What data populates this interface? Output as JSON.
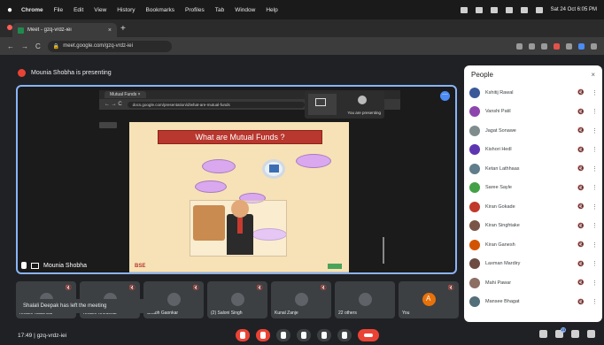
{
  "menubar": {
    "apple": "",
    "items": [
      "Chrome",
      "File",
      "Edit",
      "View",
      "History",
      "Bookmarks",
      "Profiles",
      "Tab",
      "Window",
      "Help"
    ],
    "clock": "Sat 24 Oct 6:05 PM"
  },
  "browser": {
    "tab_title": "Meet - gzq-vrdz-iei",
    "tab_close": "×",
    "new_tab": "+",
    "url": "meet.google.com/gzq-vrdz-iei",
    "nav_back": "←",
    "nav_forward": "→",
    "nav_reload": "C",
    "lock": "🔒"
  },
  "meet": {
    "presenting_banner": "Mounia Shobha is presenting",
    "more_button": "⋯",
    "shared_screen": {
      "inner_tab": "Mutual Funds ×",
      "inner_url": "docs.google.com/presentation/d/what-are-mutual-funds",
      "nav": "← → C",
      "floating_label": "You are presenting",
      "slide_title": "What are Mutual Funds ?",
      "footer_logo": "BSE"
    },
    "presenter_name": "Mounia Shobha",
    "toast": "Shalali Deepak has left the meeting",
    "thumbnails": [
      {
        "name": "Khushi Kalamkar",
        "mute": "🔇",
        "orange": false
      },
      {
        "name": "Khushi Khedekar",
        "mute": "🔇",
        "orange": false
      },
      {
        "name": "Shubh Gaonkar",
        "mute": "🔇",
        "orange": false
      },
      {
        "name": "(2) Saloni Singh",
        "mute": "🔇",
        "orange": false
      },
      {
        "name": "Kunal Zanje",
        "mute": "🔇",
        "orange": false
      },
      {
        "name": "22 others",
        "mute": "",
        "orange": false
      },
      {
        "name": "You",
        "mute": "🔇",
        "orange": true
      }
    ],
    "time": "17:49 | gzq-vrdz-iei",
    "right_badge": "23"
  },
  "people": {
    "title": "People",
    "close": "×",
    "rows": [
      {
        "name": "Kshitij Rawal",
        "mic": "🔇",
        "color": "#3b5998"
      },
      {
        "name": "Vanshi Patil",
        "mic": "🔇",
        "color": "#8e44ad"
      },
      {
        "name": "Jagat Sonawe",
        "mic": "🔇",
        "color": "#7f8c8d"
      },
      {
        "name": "Kishori Hedl",
        "mic": "🔇",
        "color": "#5e35b1"
      },
      {
        "name": "Ketan Lathhaas",
        "mic": "🔇",
        "color": "#607d8b"
      },
      {
        "name": "Saree Sayle",
        "mic": "🔇",
        "color": "#43a047"
      },
      {
        "name": "Kiran Gokade",
        "mic": "🔇",
        "color": "#c0392b"
      },
      {
        "name": "Kiran Singhtake",
        "mic": "🔇",
        "color": "#795548"
      },
      {
        "name": "Kiran Ganesh",
        "mic": "🔇",
        "color": "#d35400"
      },
      {
        "name": "Laxman Mardiry",
        "mic": "🔇",
        "color": "#6d4c41"
      },
      {
        "name": "Mahi Pawar",
        "mic": "🔇",
        "color": "#8d6e63"
      },
      {
        "name": "Mansee Bhagat",
        "mic": "🔇",
        "color": "#546e7a"
      }
    ]
  }
}
